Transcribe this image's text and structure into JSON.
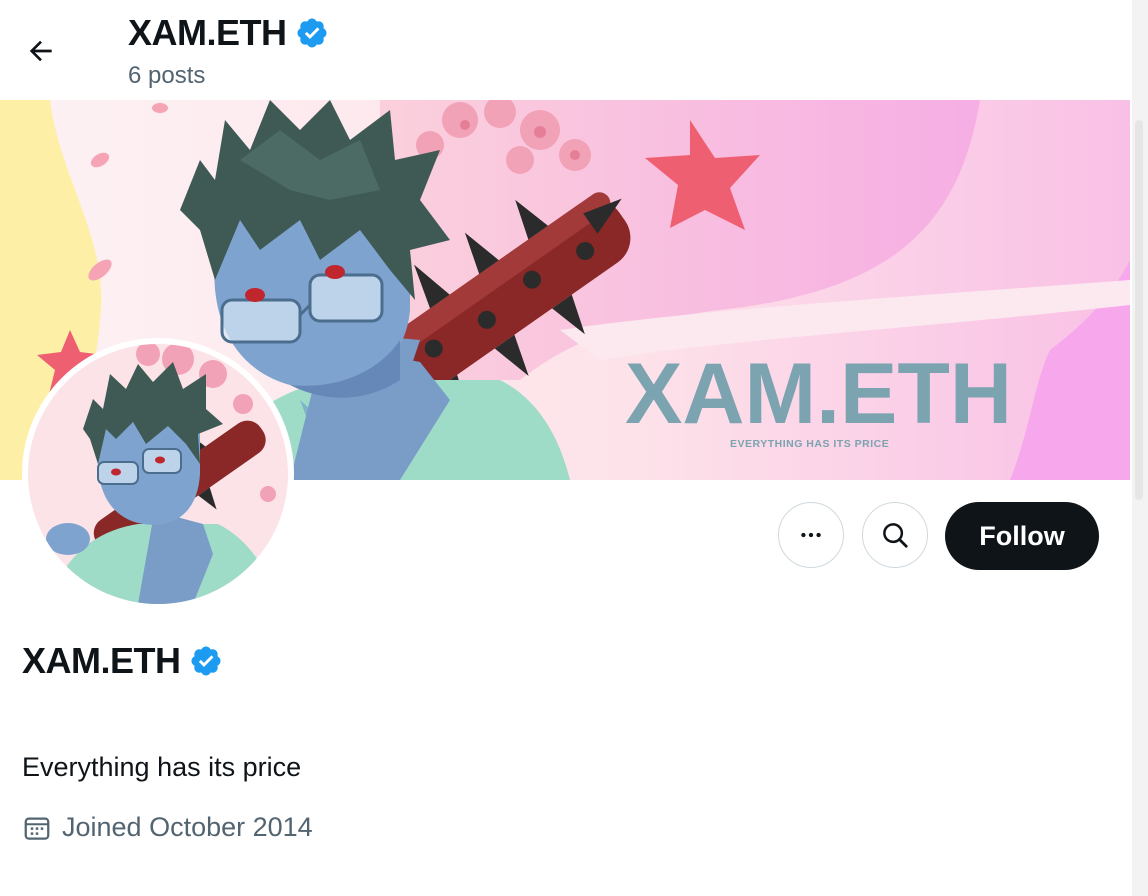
{
  "header": {
    "title": "XAM.ETH",
    "posts_count": "6 posts"
  },
  "banner": {
    "headline": "XAM.ETH",
    "tagline": "EVERYTHING HAS ITS PRICE"
  },
  "actions": {
    "follow_label": "Follow"
  },
  "profile": {
    "display_name": "XAM.ETH",
    "verified": true,
    "bio": "Everything has its price",
    "joined": "Joined October 2014"
  },
  "colors": {
    "verified_blue": "#1d9bf0",
    "follow_bg": "#0f1419",
    "secondary_text": "#536471",
    "banner_text": "#7ba3b0",
    "star": "#ef5f72"
  },
  "icons": [
    "back-arrow-icon",
    "verified-badge-icon",
    "more-icon",
    "search-icon",
    "calendar-icon"
  ]
}
